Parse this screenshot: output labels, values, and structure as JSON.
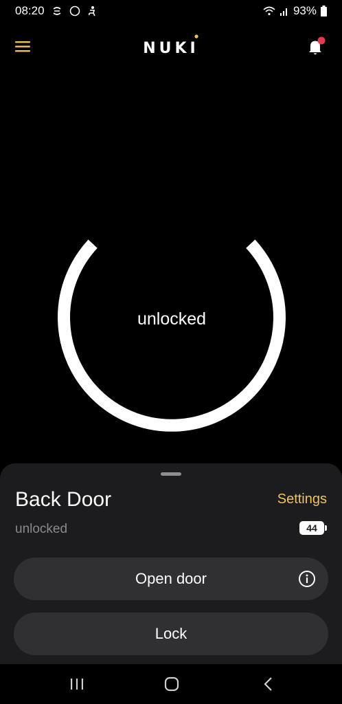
{
  "status_bar": {
    "time": "08:20",
    "battery_percent": "93%"
  },
  "header": {
    "brand": "NUKI"
  },
  "lock_ring": {
    "state_label": "unlocked"
  },
  "sheet": {
    "lock_name": "Back Door",
    "settings_label": "Settings",
    "state_text": "unlocked",
    "battery_level": "44",
    "open_door_label": "Open door",
    "lock_label": "Lock"
  },
  "colors": {
    "accent": "#f2c457",
    "notification_dot": "#e8384f",
    "sheet_bg": "#1c1c1e",
    "button_bg": "#303032"
  },
  "icons": {
    "menu": "hamburger-icon",
    "notifications": "bell-icon",
    "info": "info-icon",
    "nav_recents": "recents-icon",
    "nav_home": "home-icon",
    "nav_back": "back-icon"
  }
}
